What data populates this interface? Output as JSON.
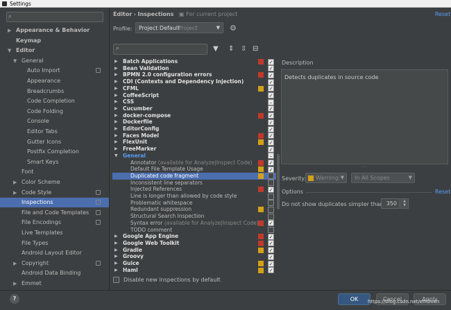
{
  "window": {
    "title": "Settings"
  },
  "sidebar": {
    "search_placeholder": "",
    "items": [
      {
        "label": "Appearance & Behavior",
        "level": 0,
        "arrow": "▶",
        "bold": true
      },
      {
        "label": "Keymap",
        "level": 0,
        "arrow": "",
        "bold": true
      },
      {
        "label": "Editor",
        "level": 0,
        "arrow": "▼",
        "bold": true
      },
      {
        "label": "General",
        "level": 1,
        "arrow": "▼"
      },
      {
        "label": "Auto Import",
        "level": 2,
        "arrow": "",
        "cfg": true
      },
      {
        "label": "Appearance",
        "level": 2,
        "arrow": ""
      },
      {
        "label": "Breadcrumbs",
        "level": 2,
        "arrow": ""
      },
      {
        "label": "Code Completion",
        "level": 2,
        "arrow": ""
      },
      {
        "label": "Code Folding",
        "level": 2,
        "arrow": ""
      },
      {
        "label": "Console",
        "level": 2,
        "arrow": ""
      },
      {
        "label": "Editor Tabs",
        "level": 2,
        "arrow": ""
      },
      {
        "label": "Gutter Icons",
        "level": 2,
        "arrow": ""
      },
      {
        "label": "Postfix Completion",
        "level": 2,
        "arrow": ""
      },
      {
        "label": "Smart Keys",
        "level": 2,
        "arrow": ""
      },
      {
        "label": "Font",
        "level": 1,
        "arrow": ""
      },
      {
        "label": "Color Scheme",
        "level": 1,
        "arrow": "▶"
      },
      {
        "label": "Code Style",
        "level": 1,
        "arrow": "▶",
        "cfg": true
      },
      {
        "label": "Inspections",
        "level": 1,
        "arrow": "",
        "cfg": true,
        "selected": true
      },
      {
        "label": "File and Code Templates",
        "level": 1,
        "arrow": "",
        "cfg": true
      },
      {
        "label": "File Encodings",
        "level": 1,
        "arrow": "",
        "cfg": true
      },
      {
        "label": "Live Templates",
        "level": 1,
        "arrow": ""
      },
      {
        "label": "File Types",
        "level": 1,
        "arrow": ""
      },
      {
        "label": "Android Layout Editor",
        "level": 1,
        "arrow": ""
      },
      {
        "label": "Copyright",
        "level": 1,
        "arrow": "▶",
        "cfg": true
      },
      {
        "label": "Android Data Binding",
        "level": 1,
        "arrow": ""
      },
      {
        "label": "Emmet",
        "level": 1,
        "arrow": "▶"
      }
    ]
  },
  "header": {
    "breadcrumb_editor": "Editor",
    "breadcrumb_sep": "›",
    "breadcrumb_inspections": "Inspections",
    "for_project": "For current project",
    "reset": "Reset"
  },
  "profile": {
    "label": "Profile:",
    "value": "Project Default",
    "scope": "Project"
  },
  "inspections": [
    {
      "label": "Batch Applications",
      "type": "cat",
      "sev": "#c0392b",
      "chk": "on"
    },
    {
      "label": "Bean Validation",
      "type": "cat",
      "sev": "",
      "chk": "on"
    },
    {
      "label": "BPMN 2.0 configuration errors",
      "type": "cat",
      "sev": "#c0392b",
      "chk": "on"
    },
    {
      "label": "CDI (Contexts and Dependency Injection)",
      "type": "cat",
      "sev": "",
      "chk": "on"
    },
    {
      "label": "CFML",
      "type": "cat",
      "sev": "#d4a017",
      "chk": "on"
    },
    {
      "label": "CoffeeScript",
      "type": "cat",
      "sev": "",
      "chk": "on"
    },
    {
      "label": "CSS",
      "type": "cat",
      "sev": "",
      "chk": "mixed"
    },
    {
      "label": "Cucumber",
      "type": "cat",
      "sev": "",
      "chk": "on"
    },
    {
      "label": "docker-compose",
      "type": "cat",
      "sev": "#c0392b",
      "chk": "on"
    },
    {
      "label": "Dockerfile",
      "type": "cat",
      "sev": "",
      "chk": "on"
    },
    {
      "label": "EditorConfig",
      "type": "cat",
      "sev": "",
      "chk": "on"
    },
    {
      "label": "Faces Model",
      "type": "cat",
      "sev": "#c0392b",
      "chk": "on"
    },
    {
      "label": "FlexUnit",
      "type": "cat",
      "sev": "#d4a017",
      "chk": "on"
    },
    {
      "label": "FreeMarker",
      "type": "cat",
      "sev": "",
      "chk": "on"
    },
    {
      "label": "General",
      "type": "cat",
      "sev": "",
      "chk": "mixed",
      "open": true
    },
    {
      "label": "Annotator",
      "note": " (available for Analyze|Inspect Code)",
      "type": "item",
      "sev": "#c0392b",
      "chk": "on"
    },
    {
      "label": "Default File Template Usage",
      "type": "item",
      "sev": "#d4a017",
      "chk": "on"
    },
    {
      "label": "Duplicated code fragment",
      "type": "item",
      "sev": "#d4a017",
      "chk": "off",
      "selected": true
    },
    {
      "label": "Inconsistent line separators",
      "type": "item",
      "sev": "",
      "chk": "off"
    },
    {
      "label": "Injected References",
      "type": "item",
      "sev": "#c0392b",
      "chk": "on"
    },
    {
      "label": "Line is longer than allowed by code style",
      "type": "item",
      "sev": "",
      "chk": "off"
    },
    {
      "label": "Problematic whitespace",
      "type": "item",
      "sev": "",
      "chk": "off"
    },
    {
      "label": "Redundant suppression",
      "type": "item",
      "sev": "#d4a017",
      "chk": "off"
    },
    {
      "label": "Structural Search Inspection",
      "type": "item",
      "sev": "",
      "chk": "off"
    },
    {
      "label": "Syntax error",
      "note": " (available for Analyze|Inspect Code)",
      "type": "item",
      "sev": "#c0392b",
      "chk": "on"
    },
    {
      "label": "TODO comment",
      "type": "item",
      "sev": "",
      "chk": "off"
    },
    {
      "label": "Google App Engine",
      "type": "cat",
      "sev": "#c0392b",
      "chk": "on"
    },
    {
      "label": "Google Web Toolkit",
      "type": "cat",
      "sev": "#c0392b",
      "chk": "on"
    },
    {
      "label": "Gradle",
      "type": "cat",
      "sev": "#d4a017",
      "chk": "on"
    },
    {
      "label": "Groovy",
      "type": "cat",
      "sev": "",
      "chk": "on"
    },
    {
      "label": "Guice",
      "type": "cat",
      "sev": "#d4a017",
      "chk": "on"
    },
    {
      "label": "Haml",
      "type": "cat",
      "sev": "#d4a017",
      "chk": "on"
    }
  ],
  "disable_new": "Disable new inspections by default",
  "description": {
    "label": "Description",
    "text": "Detects duplicates in source code"
  },
  "severity": {
    "label": "Severity:",
    "value": "Warning",
    "scope": "In All Scopes",
    "color": "#d4a017"
  },
  "options": {
    "label": "Options",
    "reset": "Reset",
    "dup_label": "Do not show duplicates simpler than:",
    "dup_value": "350"
  },
  "buttons": {
    "ok": "OK",
    "cancel": "Cancel",
    "apply": "Apply",
    "help": "?"
  },
  "watermark": "https://blog.csdn.net/embven"
}
